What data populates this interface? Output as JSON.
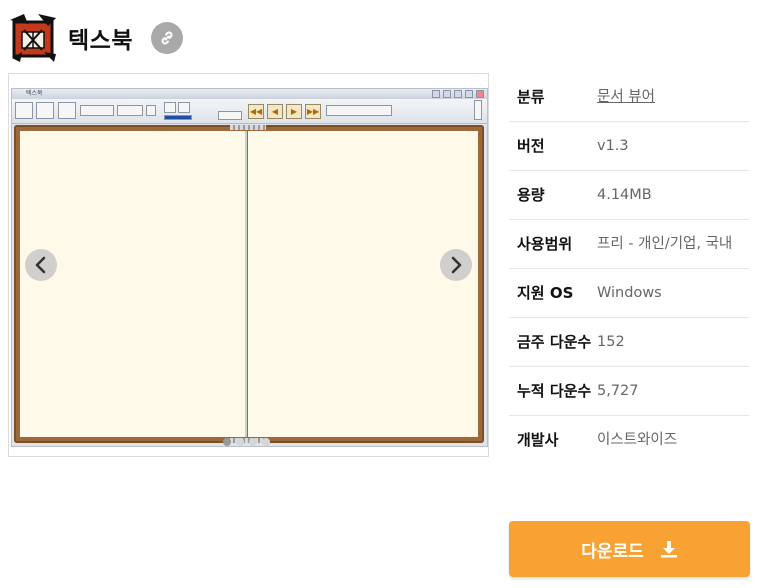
{
  "app": {
    "title": "텍스북"
  },
  "gallery": {
    "screenshot_window_title": "텍스북",
    "slide_count": 4,
    "active_slide": 1
  },
  "info": {
    "rows": [
      {
        "label": "분류",
        "value": "문서 뷰어",
        "is_link": true
      },
      {
        "label": "버전",
        "value": "v1.3"
      },
      {
        "label": "용량",
        "value": "4.14MB"
      },
      {
        "label": "사용범위",
        "value": "프리 - 개인/기업, 국내"
      },
      {
        "label": "지원 OS",
        "value": "Windows"
      },
      {
        "label": "금주 다운수",
        "value": "152"
      },
      {
        "label": "누적 다운수",
        "value": "5,727"
      },
      {
        "label": "개발사",
        "value": "이스트와이즈"
      }
    ]
  },
  "download": {
    "label": "다운로드"
  },
  "icons": {
    "link": "link-icon",
    "prev": "chevron-left-icon",
    "next": "chevron-right-icon",
    "download": "download-icon"
  },
  "colors": {
    "accent": "#f7a233",
    "link_btn": "#a9a9a9"
  }
}
